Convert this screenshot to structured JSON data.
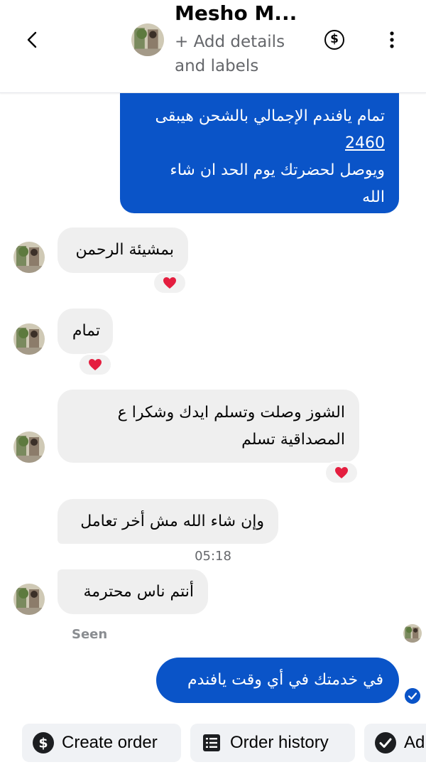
{
  "header": {
    "title": "Mesho M...",
    "subtitle": "+ Add details and labels",
    "dollar_symbol": "$"
  },
  "messages": [
    {
      "dir": "out",
      "lines": [
        "تمام يافندم الإجمالي بالشحن هيبقى",
        "2460",
        "ويوصل لحضرتك يوم الحد ان شاء",
        "الله"
      ]
    },
    {
      "dir": "in",
      "text": "بمشيئة الرحمن",
      "reaction": "heart"
    },
    {
      "dir": "in",
      "text": "تمام",
      "reaction": "heart"
    },
    {
      "dir": "in",
      "lines": [
        "الشوز وصلت وتسلم ايدك وشكرا ع",
        "المصداقية تسلم"
      ],
      "reaction": "heart"
    },
    {
      "dir": "in",
      "text": "وإن شاء الله مش أخر تعامل"
    },
    {
      "dir": "in",
      "text": "أنتم ناس محترمة"
    },
    {
      "dir": "out",
      "text": "في خدمتك في أي وقت يافندم"
    }
  ],
  "timestamp": "05:18",
  "seen_label": "Seen",
  "actions": [
    {
      "label": "Create order",
      "icon": "dollar-circle-icon"
    },
    {
      "label": "Order history",
      "icon": "order-list-icon"
    },
    {
      "label": "Ad",
      "icon": "check-circle-icon"
    }
  ],
  "colors": {
    "outgoing": "#0a54c8",
    "incoming": "#efefef",
    "heart": "#e41e3f"
  }
}
